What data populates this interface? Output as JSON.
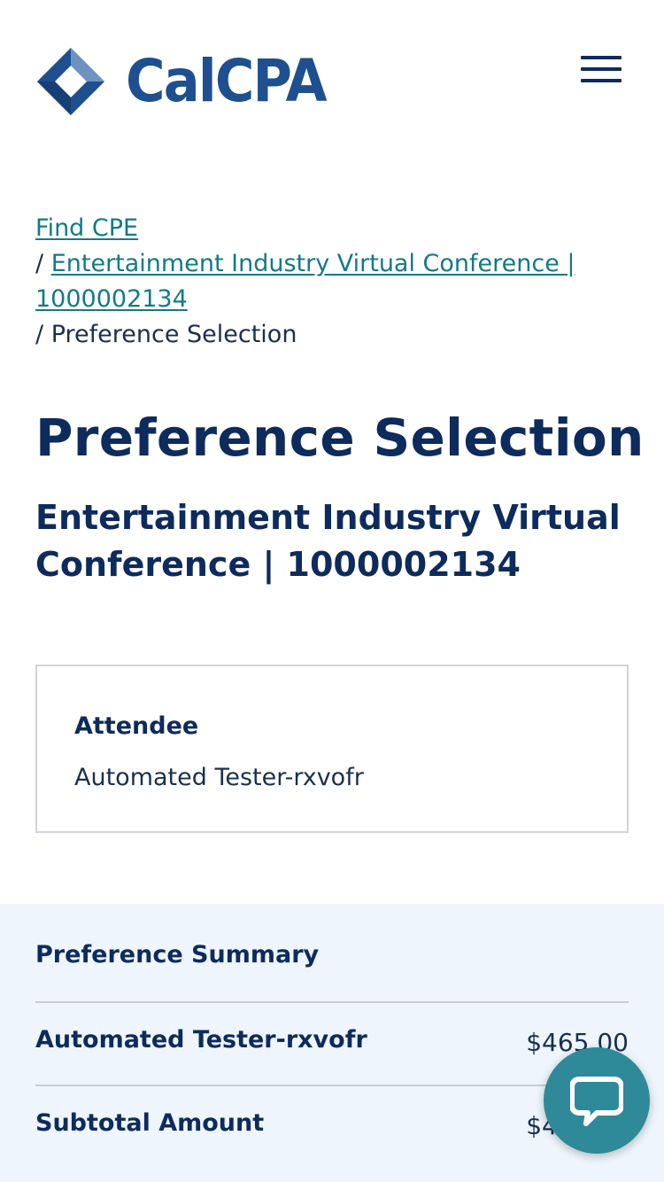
{
  "header": {
    "logo_text": "CalCPA",
    "menu_icon": "hamburger-menu-icon"
  },
  "breadcrumb": {
    "items": [
      {
        "label": "Find CPE"
      },
      {
        "label": "Entertainment Industry Virtual Conference | 1000002134"
      },
      {
        "label": "Preference Selection"
      }
    ],
    "separator": "/"
  },
  "page": {
    "title": "Preference Selection",
    "event_title": "Entertainment Industry Virtual Conference | 1000002134"
  },
  "attendee": {
    "label": "Attendee",
    "name": "Automated Tester-rxvofr"
  },
  "summary": {
    "title": "Preference Summary",
    "rows": [
      {
        "label": "Automated Tester-rxvofr",
        "value": "$465.00"
      },
      {
        "label": "Subtotal Amount",
        "value": "$465.00"
      }
    ]
  },
  "chat": {
    "icon": "chat-bubble-icon"
  },
  "colors": {
    "brand_blue": "#1e4f8f",
    "navy_text": "#0d2b5c",
    "link_teal": "#137a86",
    "summary_bg": "#eef5fd",
    "chat_button": "#2e8a99"
  }
}
